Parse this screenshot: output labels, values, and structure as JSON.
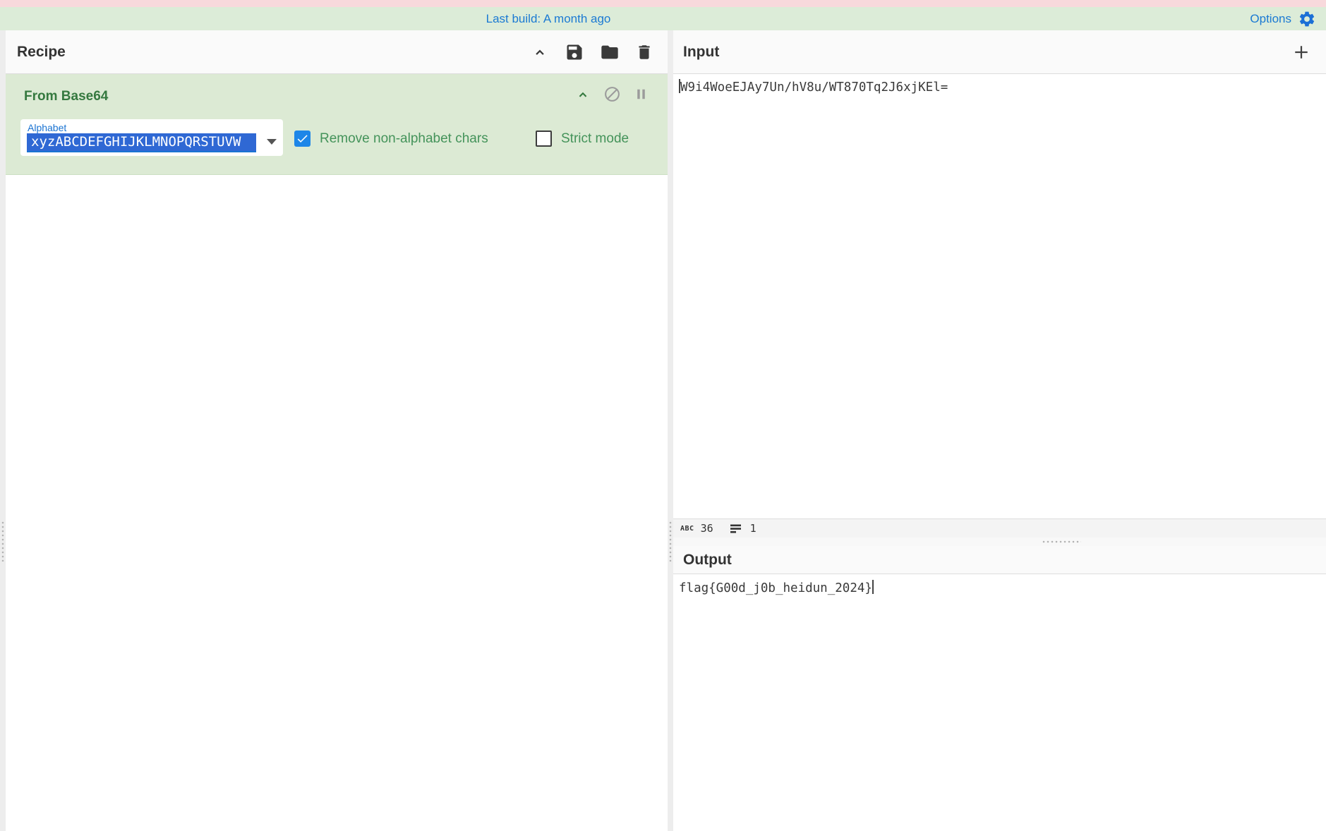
{
  "banner": {
    "last_build": "Last build: A month ago",
    "options": "Options"
  },
  "recipe": {
    "title": "Recipe",
    "operation": {
      "name": "From Base64",
      "args": {
        "alphabet_label": "Alphabet",
        "alphabet_value": "xyzABCDEFGHIJKLMNOPQRSTUVW",
        "remove_non_alphabet": "Remove non-alphabet chars",
        "strict_mode": "Strict mode"
      }
    }
  },
  "io": {
    "input": {
      "title": "Input",
      "value": "W9i4WoeEJAy7Un/hV8u/WT870Tq2J6xjKEl=",
      "char_count": "36",
      "line_count": "1"
    },
    "output": {
      "title": "Output",
      "value": "flag{G00d_j0b_heidun_2024}"
    }
  },
  "icons": {
    "header": [
      "collapse-chevron-icon",
      "save-icon",
      "folder-icon",
      "trash-icon"
    ],
    "operation": [
      "collapse-chevron-icon",
      "disable-icon",
      "pause-icon"
    ],
    "banner": [
      "gear-icon"
    ],
    "input": [
      "plus-icon"
    ],
    "status": [
      "abc-count-icon",
      "line-count-icon"
    ]
  },
  "colors": {
    "banner_pink": "#f8d9dc",
    "banner_green": "#dcecd8",
    "link_blue": "#1b7ad3",
    "operation_bg": "#dcead4",
    "operation_title_green": "#35793f",
    "arg_label_blue": "#1a73d2",
    "selection_blue": "#2f68d4",
    "checkbox_blue": "#1d86e8",
    "checkbox_label_green": "#44935a"
  }
}
